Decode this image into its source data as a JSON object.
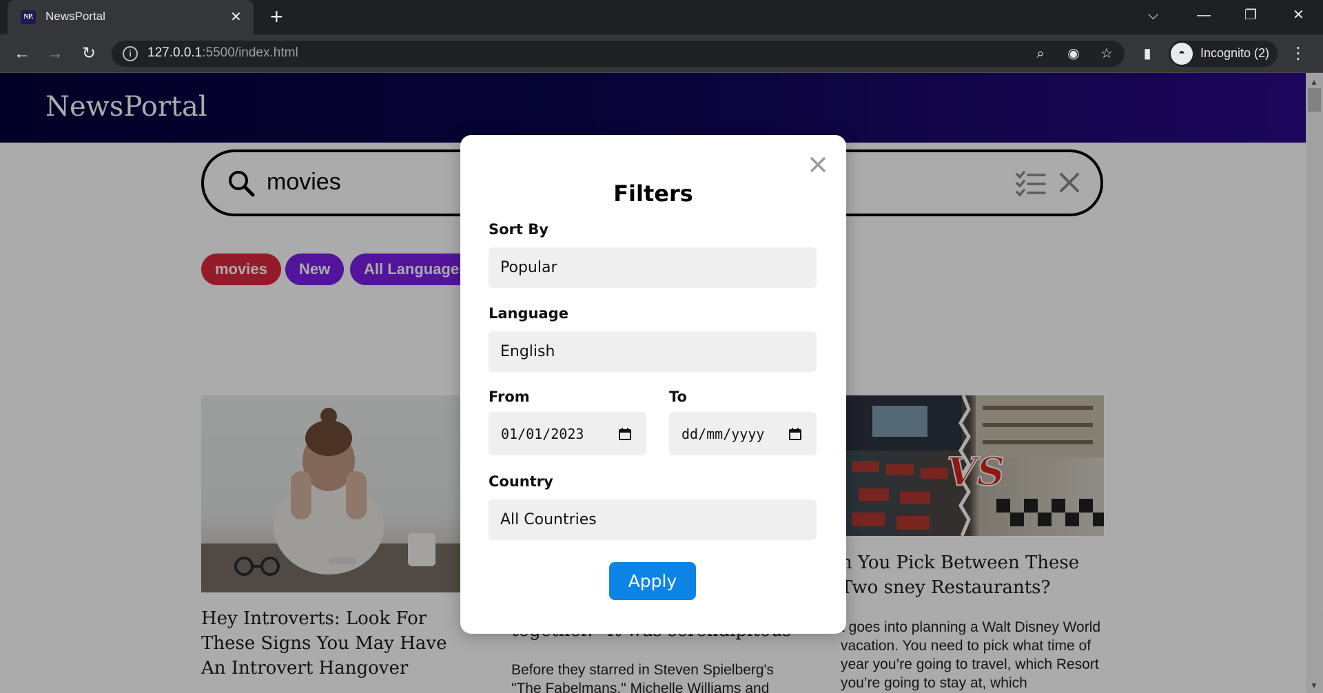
{
  "browser": {
    "tab_title": "NewsPortal",
    "favicon_text": "NP.",
    "url_host": "127.0.0.1",
    "url_rest": ":5500/index.html",
    "profile_label": "Incognito (2)"
  },
  "site": {
    "logo": "NewsPortal",
    "search_value": "movies",
    "chips": [
      "movies",
      "New",
      "All Languages"
    ]
  },
  "articles": [
    {
      "title": "Hey Introverts: Look For These Signs You May Have An Introvert Hangover",
      "description": ""
    },
    {
      "title": "together.\" It was serendipitous",
      "description": "Before they starred in Steven Spielberg's \"The Fabelmans,\" Michelle Williams and"
    },
    {
      "title": "n You Pick Between These Two sney Restaurants?",
      "description": "t goes into planning a Walt Disney World vacation. You need to pick what time of year you’re going to travel, which Resort you’re going to stay at, which"
    }
  ],
  "modal": {
    "title": "Filters",
    "sort_label": "Sort By",
    "sort_value": "Popular",
    "language_label": "Language",
    "language_value": "English",
    "from_label": "From",
    "from_value": "01/01/2023",
    "to_label": "To",
    "to_value": "dd/mm/yyyy",
    "country_label": "Country",
    "country_value": "All Countries",
    "apply_label": "Apply"
  },
  "colors": {
    "header_start": "#05003b",
    "header_end": "#2b0b8a",
    "chip_red": "#e0293f",
    "chip_purple": "#7b1fe6",
    "apply_blue": "#0b84e5"
  }
}
